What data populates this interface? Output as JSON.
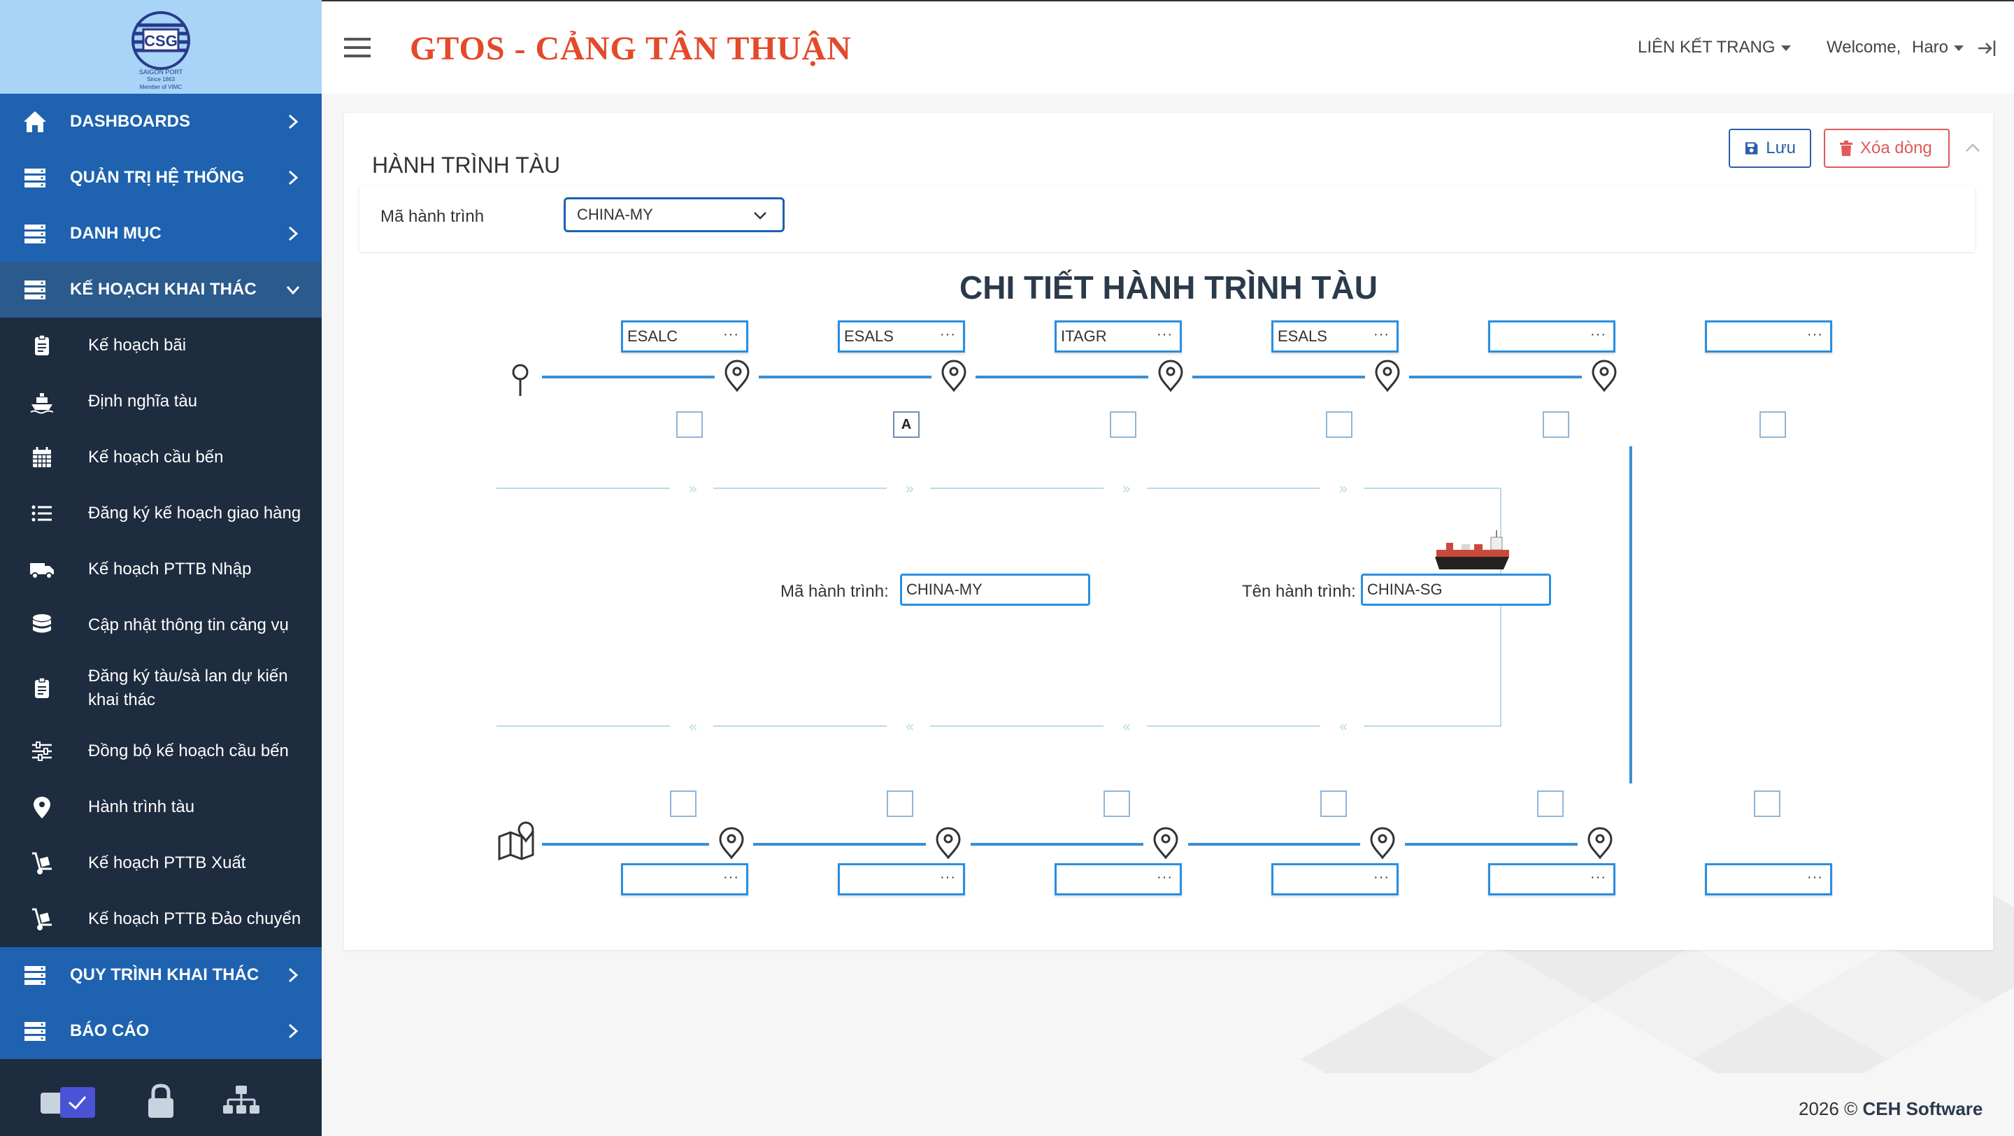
{
  "sidebar": {
    "logo": {
      "label": "CSG",
      "arc_text": "SAIGON PORT",
      "since": "Since 1863",
      "member": "Member of VIMC"
    },
    "main_items": [
      {
        "label": "DASHBOARDS",
        "icon": "home-icon"
      },
      {
        "label": "QUẢN TRỊ HỆ THỐNG",
        "icon": "server-icon"
      },
      {
        "label": "DANH MỤC",
        "icon": "server-icon"
      },
      {
        "label": "KẾ HOẠCH KHAI THÁC",
        "icon": "server-icon",
        "expanded": true
      },
      {
        "label": "QUY TRÌNH KHAI THÁC",
        "icon": "server-icon"
      },
      {
        "label": "BÁO CÁO",
        "icon": "server-icon"
      }
    ],
    "sub_items": [
      {
        "label": "Kế hoạch bãi",
        "icon": "clipboard-icon"
      },
      {
        "label": "Định nghĩa tàu",
        "icon": "ship-icon"
      },
      {
        "label": "Kế hoạch cầu bến",
        "icon": "calendar-icon"
      },
      {
        "label": "Đăng ký kế hoạch giao hàng",
        "icon": "list-icon"
      },
      {
        "label": "Kế hoạch PTTB Nhập",
        "icon": "truck-icon"
      },
      {
        "label": "Cập nhật thông tin cảng vụ",
        "icon": "database-icon"
      },
      {
        "label": "Đăng ký tàu/sà lan dự kiến khai thác",
        "icon": "clipboard-icon"
      },
      {
        "label": "Đồng bộ kế hoạch cầu bến",
        "icon": "sliders-icon"
      },
      {
        "label": "Hành trình tàu",
        "icon": "map-marker-icon"
      },
      {
        "label": "Kế hoạch PTTB Xuất",
        "icon": "dolly-icon"
      },
      {
        "label": "Kế hoạch PTTB Đảo chuyển",
        "icon": "dolly-icon"
      }
    ],
    "bottom_icons": [
      "toggle-checkbox-icon",
      "lock-icon",
      "sitemap-icon"
    ]
  },
  "topbar": {
    "app_title": "GTOS - CẢNG TÂN THUẬN",
    "link_pages": "LIÊN KẾT TRANG",
    "welcome": "Welcome,",
    "user": "Haro",
    "colors": {
      "title": "#e24a2a",
      "accent": "#1e62b0"
    }
  },
  "card": {
    "title": "HÀNH TRÌNH TÀU",
    "save_label": "Lưu",
    "delete_label": "Xóa dòng",
    "filter_label": "Mã hành trình",
    "filter_value": "CHINA-MY"
  },
  "detail": {
    "title": "CHI TIẾT HÀNH TRÌNH TÀU",
    "dots": "···",
    "top_ports": [
      "ESALC",
      "ESALS",
      "ITAGR",
      "ESALS",
      "",
      ""
    ],
    "top_checks": [
      "",
      "A",
      "",
      "",
      "",
      ""
    ],
    "bottom_ports": [
      "",
      "",
      "",
      "",
      "",
      ""
    ],
    "bottom_checks": [
      "",
      "",
      "",
      "",
      "",
      ""
    ],
    "route_code_label": "Mã hành trình:",
    "route_code_value": "CHINA-MY",
    "route_name_label": "Tên hành trình:",
    "route_name_value": "CHINA-SG"
  },
  "footer": {
    "year": "2026 ©",
    "company": "CEH Software"
  }
}
